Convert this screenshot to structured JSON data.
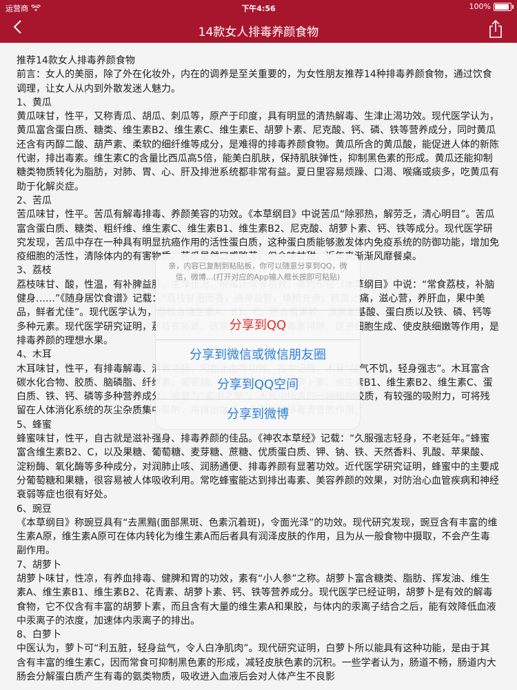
{
  "status_bar": {
    "carrier": "运营商",
    "time": "下午4:56",
    "battery": "100%"
  },
  "nav": {
    "title": "14款女人排毒养颜食物"
  },
  "article": {
    "lines": [
      "推荐14款女人排毒养颜食物",
      "前言：女人的美丽，除了外在化妆外，内在的调养是至关重要的，为女性朋友推荐14种排毒养颜食物，通过饮食调理，让女人从内到外散发迷人魅力。",
      "1、黄瓜",
      "黄瓜味甘，性平，又称青瓜、胡瓜、刺瓜等，原产于印度，具有明显的清热解毒、生津止渴功效。现代医学认为，黄瓜富含蛋白质、糖类、维生素B2、维生素C、维生素E、胡萝卜素、尼克酸、钙、磷、铁等营养成分，同时黄瓜还含有丙醇二酸、葫芦素、柔软的细纤维等成分，是难得的排毒养颜食物。黄瓜所含的黄瓜酸，能促进人体的新陈代谢，排出毒素。维生素C的含量比西瓜高5倍，能美白肌肤，保持肌肤弹性，抑制黑色素的形成。黄瓜还能抑制糖类物质转化为脂肪，对肺、胃、心、肝及排泄系统都非常有益。夏日里容易烦躁、口渴、喉痛或痰多，吃黄瓜有助于化解炎症。",
      "2、苦瓜",
      "苦瓜味甘，性平。苦瓜有解毒排毒、养颜美容的功效。《本草纲目》中说苦瓜“除邪热，解劳乏，清心明目”。苦瓜富含蛋白质、糖类、粗纤维、维生素C、维生素B1、维生素B2、尼克酸、胡萝卜素、钙、铁等成分。现代医学研究发现，苦瓜中存在一种具有明显抗癌作用的活性蛋白质，这种蛋白质能够激发体内免疫系统的防御功能，增加免疫细胞的活性，清除体内的有害物质。苦瓜虽然口感略苦，但余味甘甜，近年来渐渐风靡餐桌。",
      "3、荔枝",
      "荔枝味甘、酸，性温，有补脾益肝、生津止渴、解毒止泻等功效。李时珍在《本草纲目》中说：“常食荔枝，补脑健身……”《随身居饮食谱》记载：“荔枝甘温而香，通神益智，填精充液，辟臭止痛，滋心营，养肝血，果中美品，鲜者尤佳”。现代医学认为，荔枝含维生素A、B1、C，还含有果胶、游离氨基酸、蛋白质以及铁、磷、钙等多种元素。现代医学研究证明，荔枝有补肾、改善肝功能、加速毒素排除、促进细胞生成、使皮肤细嫩等作用，是排毒养颜的理想水果。",
      "4、木耳",
      "木耳味甘，性平，有排毒解毒、清胃涤肠、和血止血等功效。古书记载，木耳“益气不饥，轻身强志”。木耳富含碳水化合物、胶质、脑磷脂、纤维素、葡萄糖、木糖、卵磷脂、胡萝卜素、维生素B1、维生素B2、维生素C、蛋白质、铁、钙、磷等多种营养成分，被誉为“素中之荤”。木耳中所含的一种植物胶质，有较强的吸附力，可将残留在人体消化系统的灰尘杂质集中吸附，再排出体外，从而起到排毒清胃的作用。",
      "5、蜂蜜",
      "蜂蜜味甘，性平，自古就是滋补强身、排毒养颜的佳品。《神农本草经》记载：“久服强志轻身，不老延年。”蜂蜜富含维生素B2、C，以及果糖、葡萄糖、麦芽糖、蔗糖、优质蛋白质、钾、钠、铁、天然香料、乳酸、苹果酸、淀粉酶、氧化酶等多种成分，对润肺止咳、润肠通便、排毒养颜有显著功效。近代医学研究证明，蜂蜜中的主要成分葡萄糖和果糖，很容易被人体吸收利用。常吃蜂蜜能达到排出毒素、美容养颜的效果，对防治心血管疾病和神经衰弱等症也很有好处。",
      "6、豌豆",
      "《本草纲目》称豌豆具有“去黑黯(面部黑斑、色素沉着斑)，令面光泽”的功效。现代研究发现，豌豆含有丰富的维生素A原，维生素A原可在体内转化为维生素A而后者具有润泽皮肤的作用，且为从一般食物中摄取，不会产生毒副作用。",
      "7、胡萝卜",
      "胡萝卜味甘，性凉，有养血排毒、健脾和胃的功效，素有“小人参”之称。胡萝卜富含糖类、脂肪、挥发油、维生素A、维生素B1、维生素B2、花青素、胡萝卜素、钙、铁等营养成分。现代医学已经证明，胡萝卜是有效的解毒食物，它不仅含有丰富的胡萝卜素，而且含有大量的维生素A和果胶，与体内的汞离子结合之后，能有效降低血液中汞离子的浓度，加速体内汞离子的排出。",
      "8、白萝卜",
      "中医认为，萝卜可“利五脏，轻身益气，令人白净肌肉”。现代研究证明，白萝卜所以能具有这种功能，是由于其含有丰富的维生素C，因而常食可抑制黑色素的形成，减轻皮肤色素的沉积。一些学者认为，肠道不畅，肠道内大肠会分解蛋白质产生有毒的氨类物质，吸收进入血液后会对人体产生不良影"
    ]
  },
  "share_sheet": {
    "message": "亲，内容已复制到粘贴板，你可以随意分享到QQ，微信，微博...(打开对应的App输入框长按即可粘贴)",
    "options": [
      "分享到QQ",
      "分享到微信或微信朋友圈",
      "分享到QQ空间",
      "分享到微博"
    ],
    "option_colors": [
      "#e0302c",
      "#2f80d8",
      "#2f80d8",
      "#2f80d8"
    ]
  },
  "colors": {
    "nav_background": "#a8162e",
    "page_background": "#f4f4f4"
  }
}
